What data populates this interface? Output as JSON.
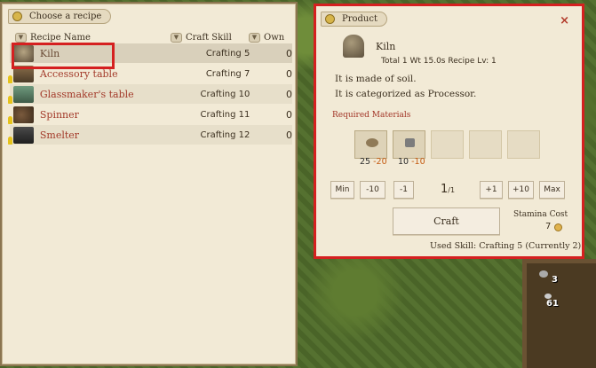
{
  "left_panel": {
    "title": "Choose a recipe",
    "col_name": "Recipe Name",
    "col_skill": "Craft Skill",
    "col_own": "Own",
    "recipes": [
      {
        "name": "Kiln",
        "skill": "Crafting 5",
        "own": "0"
      },
      {
        "name": "Accessory table",
        "skill": "Crafting 7",
        "own": "0"
      },
      {
        "name": "Glassmaker's table",
        "skill": "Crafting 10",
        "own": "0"
      },
      {
        "name": "Spinner",
        "skill": "Crafting 11",
        "own": "0"
      },
      {
        "name": "Smelter",
        "skill": "Crafting 12",
        "own": "0"
      }
    ]
  },
  "product": {
    "tab_title": "Product",
    "close": "×",
    "name": "Kiln",
    "meta": "Total 1  Wt 15.0s  Recipe Lv: 1",
    "desc1": "It is made of soil.",
    "desc2": "It is categorized as Processor.",
    "required_title": "Required Materials",
    "materials": [
      {
        "have": "25",
        "req": "-20",
        "icon": "soil-icon"
      },
      {
        "have": "10",
        "req": "-10",
        "icon": "stone-icon"
      }
    ],
    "buttons": {
      "min": "Min",
      "minus10": "-10",
      "minus1": "-1",
      "plus1": "+1",
      "plus10": "+10",
      "max": "Max"
    },
    "quantity": "1",
    "quantity_of": "/1",
    "craft": "Craft",
    "stamina_label": "Stamina Cost",
    "stamina_value": "7",
    "used_skill": "Used Skill: Crafting 5 (Currently 2)"
  },
  "hud": {
    "count_a": "3",
    "count_b": "61"
  },
  "colors": {
    "selection_box": "#d52020",
    "recipe_name": "#a33a2a",
    "panel_bg": "#f2ead6"
  }
}
